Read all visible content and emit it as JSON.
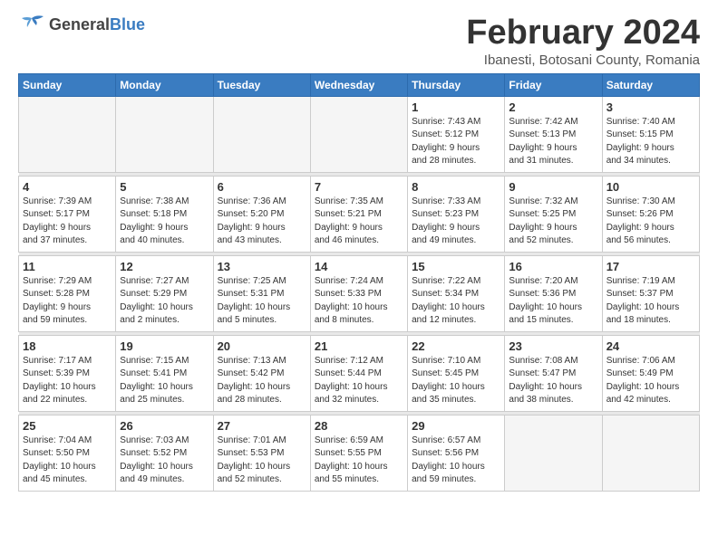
{
  "header": {
    "logo_general": "General",
    "logo_blue": "Blue",
    "month_title": "February 2024",
    "subtitle": "Ibanesti, Botosani County, Romania"
  },
  "weekdays": [
    "Sunday",
    "Monday",
    "Tuesday",
    "Wednesday",
    "Thursday",
    "Friday",
    "Saturday"
  ],
  "weeks": [
    [
      {
        "day": "",
        "info": ""
      },
      {
        "day": "",
        "info": ""
      },
      {
        "day": "",
        "info": ""
      },
      {
        "day": "",
        "info": ""
      },
      {
        "day": "1",
        "info": "Sunrise: 7:43 AM\nSunset: 5:12 PM\nDaylight: 9 hours\nand 28 minutes."
      },
      {
        "day": "2",
        "info": "Sunrise: 7:42 AM\nSunset: 5:13 PM\nDaylight: 9 hours\nand 31 minutes."
      },
      {
        "day": "3",
        "info": "Sunrise: 7:40 AM\nSunset: 5:15 PM\nDaylight: 9 hours\nand 34 minutes."
      }
    ],
    [
      {
        "day": "4",
        "info": "Sunrise: 7:39 AM\nSunset: 5:17 PM\nDaylight: 9 hours\nand 37 minutes."
      },
      {
        "day": "5",
        "info": "Sunrise: 7:38 AM\nSunset: 5:18 PM\nDaylight: 9 hours\nand 40 minutes."
      },
      {
        "day": "6",
        "info": "Sunrise: 7:36 AM\nSunset: 5:20 PM\nDaylight: 9 hours\nand 43 minutes."
      },
      {
        "day": "7",
        "info": "Sunrise: 7:35 AM\nSunset: 5:21 PM\nDaylight: 9 hours\nand 46 minutes."
      },
      {
        "day": "8",
        "info": "Sunrise: 7:33 AM\nSunset: 5:23 PM\nDaylight: 9 hours\nand 49 minutes."
      },
      {
        "day": "9",
        "info": "Sunrise: 7:32 AM\nSunset: 5:25 PM\nDaylight: 9 hours\nand 52 minutes."
      },
      {
        "day": "10",
        "info": "Sunrise: 7:30 AM\nSunset: 5:26 PM\nDaylight: 9 hours\nand 56 minutes."
      }
    ],
    [
      {
        "day": "11",
        "info": "Sunrise: 7:29 AM\nSunset: 5:28 PM\nDaylight: 9 hours\nand 59 minutes."
      },
      {
        "day": "12",
        "info": "Sunrise: 7:27 AM\nSunset: 5:29 PM\nDaylight: 10 hours\nand 2 minutes."
      },
      {
        "day": "13",
        "info": "Sunrise: 7:25 AM\nSunset: 5:31 PM\nDaylight: 10 hours\nand 5 minutes."
      },
      {
        "day": "14",
        "info": "Sunrise: 7:24 AM\nSunset: 5:33 PM\nDaylight: 10 hours\nand 8 minutes."
      },
      {
        "day": "15",
        "info": "Sunrise: 7:22 AM\nSunset: 5:34 PM\nDaylight: 10 hours\nand 12 minutes."
      },
      {
        "day": "16",
        "info": "Sunrise: 7:20 AM\nSunset: 5:36 PM\nDaylight: 10 hours\nand 15 minutes."
      },
      {
        "day": "17",
        "info": "Sunrise: 7:19 AM\nSunset: 5:37 PM\nDaylight: 10 hours\nand 18 minutes."
      }
    ],
    [
      {
        "day": "18",
        "info": "Sunrise: 7:17 AM\nSunset: 5:39 PM\nDaylight: 10 hours\nand 22 minutes."
      },
      {
        "day": "19",
        "info": "Sunrise: 7:15 AM\nSunset: 5:41 PM\nDaylight: 10 hours\nand 25 minutes."
      },
      {
        "day": "20",
        "info": "Sunrise: 7:13 AM\nSunset: 5:42 PM\nDaylight: 10 hours\nand 28 minutes."
      },
      {
        "day": "21",
        "info": "Sunrise: 7:12 AM\nSunset: 5:44 PM\nDaylight: 10 hours\nand 32 minutes."
      },
      {
        "day": "22",
        "info": "Sunrise: 7:10 AM\nSunset: 5:45 PM\nDaylight: 10 hours\nand 35 minutes."
      },
      {
        "day": "23",
        "info": "Sunrise: 7:08 AM\nSunset: 5:47 PM\nDaylight: 10 hours\nand 38 minutes."
      },
      {
        "day": "24",
        "info": "Sunrise: 7:06 AM\nSunset: 5:49 PM\nDaylight: 10 hours\nand 42 minutes."
      }
    ],
    [
      {
        "day": "25",
        "info": "Sunrise: 7:04 AM\nSunset: 5:50 PM\nDaylight: 10 hours\nand 45 minutes."
      },
      {
        "day": "26",
        "info": "Sunrise: 7:03 AM\nSunset: 5:52 PM\nDaylight: 10 hours\nand 49 minutes."
      },
      {
        "day": "27",
        "info": "Sunrise: 7:01 AM\nSunset: 5:53 PM\nDaylight: 10 hours\nand 52 minutes."
      },
      {
        "day": "28",
        "info": "Sunrise: 6:59 AM\nSunset: 5:55 PM\nDaylight: 10 hours\nand 55 minutes."
      },
      {
        "day": "29",
        "info": "Sunrise: 6:57 AM\nSunset: 5:56 PM\nDaylight: 10 hours\nand 59 minutes."
      },
      {
        "day": "",
        "info": ""
      },
      {
        "day": "",
        "info": ""
      }
    ]
  ]
}
